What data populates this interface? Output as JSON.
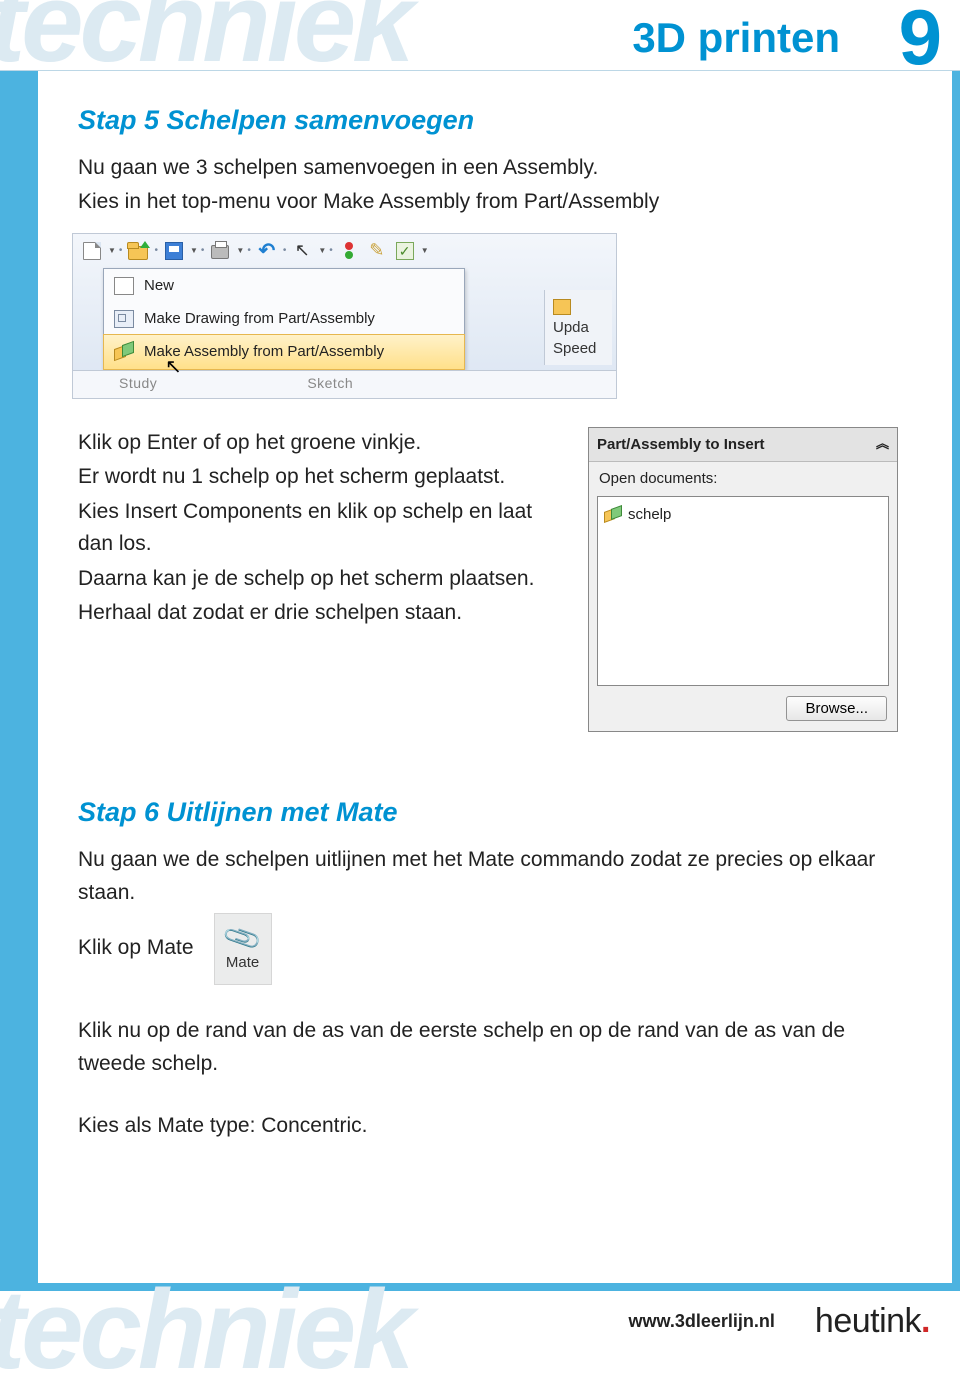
{
  "header": {
    "watermark": "techniek",
    "title": "3D printen",
    "page_number": "9"
  },
  "step5": {
    "heading": "Stap 5 Schelpen samenvoegen",
    "p1": "Nu gaan we 3 schelpen samenvoegen in een Assembly.",
    "p2": "Kies in het  top-menu voor Make Assembly from Part/Assembly",
    "after1": "Klik op Enter of op het groene vinkje.",
    "after2": "Er wordt nu 1 schelp op het scherm geplaatst.",
    "after3": "Kies Insert Components en klik op schelp en laat dan los.",
    "after4": "Daarna kan je de schelp op het scherm plaatsen.",
    "after5": "Herhaal dat zodat er drie schelpen staan."
  },
  "toolbar": {
    "menu": {
      "item1": "New",
      "item2": "Make Drawing from Part/Assembly",
      "item3": "Make Assembly from Part/Assembly"
    },
    "tabrow": {
      "study": "Study",
      "sketch": "Sketch"
    },
    "side": {
      "line1": "Upda",
      "line2": "Speed"
    }
  },
  "panel": {
    "title": "Part/Assembly to Insert",
    "subtitle": "Open documents:",
    "item": "schelp",
    "browse": "Browse..."
  },
  "step6": {
    "heading": "Stap 6 Uitlijnen met Mate",
    "p1": "Nu gaan we de schelpen uitlijnen met het Mate commando zodat ze precies op elkaar staan.",
    "p2": "Klik op Mate",
    "mate_label": "Mate",
    "p3": "Klik nu op de rand van de as van de eerste schelp en op de rand van de as van de tweede schelp.",
    "p4": "Kies als Mate type: Concentric."
  },
  "footer": {
    "watermark": "techniek",
    "url": "www.3dleerlijn.nl",
    "brand": "heutink",
    "brand_dot": "."
  }
}
